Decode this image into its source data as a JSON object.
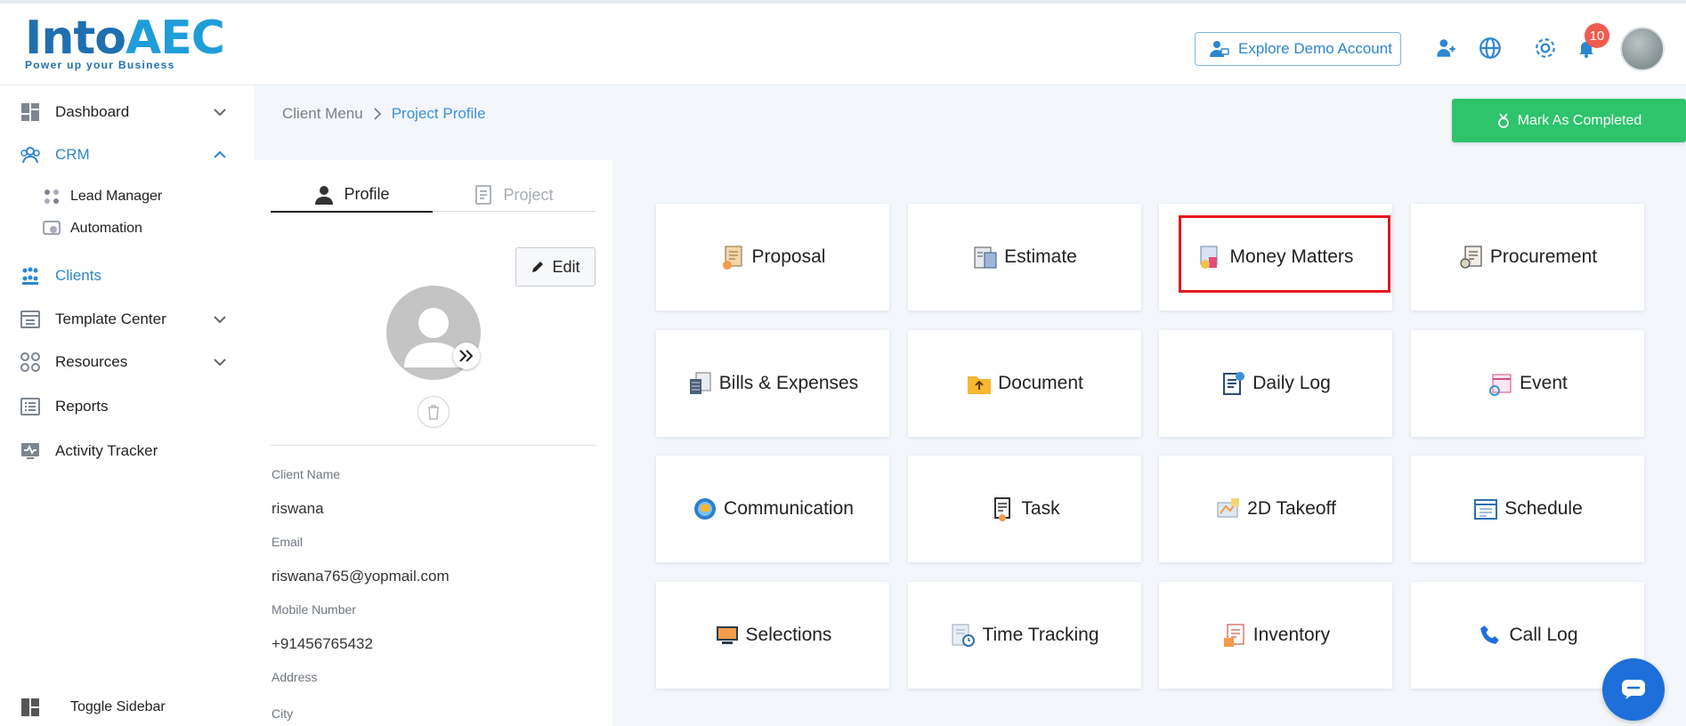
{
  "header": {
    "logo_main": "Into",
    "logo_accent": "AEC",
    "logo_tagline": "Power up your Business",
    "demo_button": "Explore Demo Account",
    "notification_count": "10",
    "icons": [
      "add-user-icon",
      "globe-icon",
      "gear-icon",
      "bell-icon"
    ]
  },
  "sidebar": {
    "items": [
      {
        "label": "Dashboard",
        "icon": "dashboard-icon"
      },
      {
        "label": "CRM",
        "icon": "crm-icon"
      },
      {
        "label": "Lead Manager",
        "icon": "lead-manager-icon"
      },
      {
        "label": "Automation",
        "icon": "automation-icon"
      },
      {
        "label": "Clients",
        "icon": "clients-icon"
      },
      {
        "label": "Template Center",
        "icon": "template-icon"
      },
      {
        "label": "Resources",
        "icon": "resources-icon"
      },
      {
        "label": "Reports",
        "icon": "reports-icon"
      },
      {
        "label": "Activity Tracker",
        "icon": "activity-icon"
      }
    ],
    "toggle": "Toggle Sidebar"
  },
  "breadcrumb": {
    "parent": "Client Menu",
    "current": "Project Profile"
  },
  "complete_button": "Mark As Completed",
  "profile": {
    "tab_profile": "Profile",
    "tab_project": "Project",
    "edit_button": "Edit",
    "fields": [
      {
        "label": "Client Name",
        "value": "riswana"
      },
      {
        "label": "Email",
        "value": "riswana765@yopmail.com"
      },
      {
        "label": "Mobile Number",
        "value": "+91456765432"
      },
      {
        "label": "Address",
        "value": ""
      },
      {
        "label": "City",
        "value": ""
      }
    ]
  },
  "modules": [
    {
      "label": "Proposal",
      "icon": "proposal-icon"
    },
    {
      "label": "Estimate",
      "icon": "estimate-icon"
    },
    {
      "label": "Money Matters",
      "icon": "money-matters-icon"
    },
    {
      "label": "Procurement",
      "icon": "procurement-icon"
    },
    {
      "label": "Bills & Expenses",
      "icon": "bills-icon"
    },
    {
      "label": "Document",
      "icon": "document-icon"
    },
    {
      "label": "Daily Log",
      "icon": "daily-log-icon"
    },
    {
      "label": "Event",
      "icon": "event-icon"
    },
    {
      "label": "Communication",
      "icon": "communication-icon"
    },
    {
      "label": "Task",
      "icon": "task-icon"
    },
    {
      "label": "2D Takeoff",
      "icon": "takeoff-icon"
    },
    {
      "label": "Schedule",
      "icon": "schedule-icon"
    },
    {
      "label": "Selections",
      "icon": "selections-icon"
    },
    {
      "label": "Time Tracking",
      "icon": "time-tracking-icon"
    },
    {
      "label": "Inventory",
      "icon": "inventory-icon"
    },
    {
      "label": "Call Log",
      "icon": "call-log-icon"
    }
  ],
  "colors": {
    "accent": "#2b86d2",
    "success": "#2dc46c",
    "highlight": "#e3181f",
    "badge": "#f15b4f"
  }
}
